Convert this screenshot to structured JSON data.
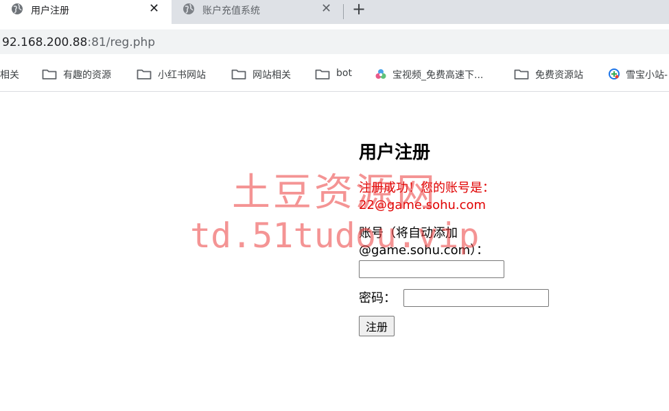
{
  "browser": {
    "tabs": [
      {
        "title": "用户注册",
        "close": "✕",
        "active": true
      },
      {
        "title": "账户充值系统",
        "close": "✕",
        "active": false
      }
    ],
    "new_tab": "+",
    "address": {
      "host": "92.168.200.88",
      "port": ":81",
      "path": "/reg.php"
    },
    "bookmarks": [
      {
        "label": "相关",
        "icon": "none"
      },
      {
        "label": "有趣的资源",
        "icon": "folder-icon"
      },
      {
        "label": "小红书网站",
        "icon": "folder-icon"
      },
      {
        "label": "网站相关",
        "icon": "folder-icon"
      },
      {
        "label": "bot",
        "icon": "folder-icon"
      },
      {
        "label": "宝视频_免费高速下...",
        "icon": "site-favicon"
      },
      {
        "label": "免费资源站",
        "icon": "folder-icon"
      },
      {
        "label": "雪宝小站-",
        "icon": "site-favicon"
      }
    ]
  },
  "page": {
    "title": "用户注册",
    "success_message": "注册成功！您的账号是：22@game.sohu.com",
    "account_label": "账号（将自动添加@game.sohu.com）：",
    "account_value": "",
    "password_label": "密码：",
    "password_value": "",
    "submit_label": "注册"
  },
  "watermark": {
    "line1": "土豆资源网",
    "line2": "td.51tudou.vip"
  },
  "colors": {
    "tabstrip": "#dee1e6",
    "success_text": "#e00000",
    "watermark": "#eb3c3c"
  }
}
